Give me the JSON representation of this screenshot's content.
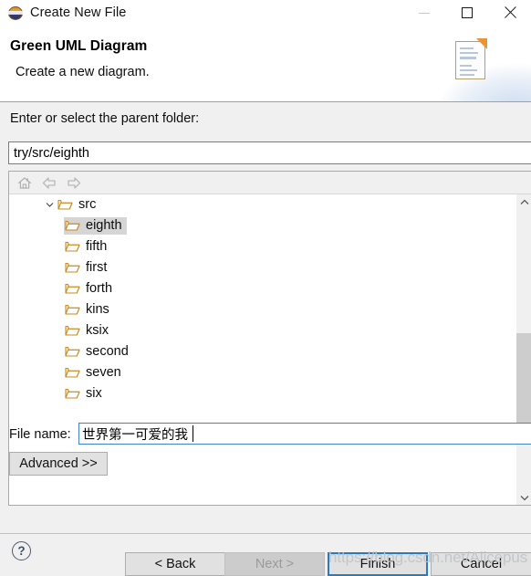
{
  "window": {
    "title": "Create New File",
    "app_icon": "eclipse-sphere-icon",
    "controls": {
      "minimize": "minimize-icon",
      "maximize": "maximize-icon",
      "close": "close-icon"
    }
  },
  "header": {
    "title": "Green UML Diagram",
    "subtitle": "Create a new diagram.",
    "banner_icon": "new-file-document-icon"
  },
  "main": {
    "parent_folder_label": "Enter or select the parent folder:",
    "parent_folder_value": "try/src/eighth",
    "tree_toolbar": [
      {
        "name": "home-icon",
        "label": "Home"
      },
      {
        "name": "back-arrow-icon",
        "label": "Back"
      },
      {
        "name": "forward-arrow-icon",
        "label": "Forward"
      }
    ],
    "tree": [
      {
        "label": "src",
        "level": 1,
        "expanded": true,
        "selected": false,
        "icon": "folder-icon"
      },
      {
        "label": "eighth",
        "level": 2,
        "expanded": false,
        "selected": true,
        "icon": "folder-icon"
      },
      {
        "label": "fifth",
        "level": 2,
        "expanded": false,
        "selected": false,
        "icon": "folder-icon"
      },
      {
        "label": "first",
        "level": 2,
        "expanded": false,
        "selected": false,
        "icon": "folder-icon"
      },
      {
        "label": "forth",
        "level": 2,
        "expanded": false,
        "selected": false,
        "icon": "folder-icon"
      },
      {
        "label": "kins",
        "level": 2,
        "expanded": false,
        "selected": false,
        "icon": "folder-icon"
      },
      {
        "label": "ksix",
        "level": 2,
        "expanded": false,
        "selected": false,
        "icon": "folder-icon"
      },
      {
        "label": "second",
        "level": 2,
        "expanded": false,
        "selected": false,
        "icon": "folder-icon"
      },
      {
        "label": "seven",
        "level": 2,
        "expanded": false,
        "selected": false,
        "icon": "folder-icon"
      },
      {
        "label": "six",
        "level": 2,
        "expanded": false,
        "selected": false,
        "icon": "folder-icon"
      }
    ],
    "file_name_label": "File name:",
    "file_name_value": "世界第一可爱的我",
    "advanced_label": "Advanced >>"
  },
  "footer": {
    "help_label": "?",
    "back_label": "< Back",
    "next_label": "Next >",
    "next_disabled": true,
    "finish_label": "Finish",
    "finish_focused": true,
    "cancel_label": "Cancel"
  },
  "overlay": {
    "watermark": "https://blog.csdn.net/Alicepus"
  },
  "colors": {
    "dialog_bg": "#f0f0f0",
    "panel_bg": "#ffffff",
    "selection": "#d5d5d5",
    "focus_border": "#2a7ac0",
    "folder": "#e8a33d",
    "disabled_text": "#9a9a9a"
  }
}
